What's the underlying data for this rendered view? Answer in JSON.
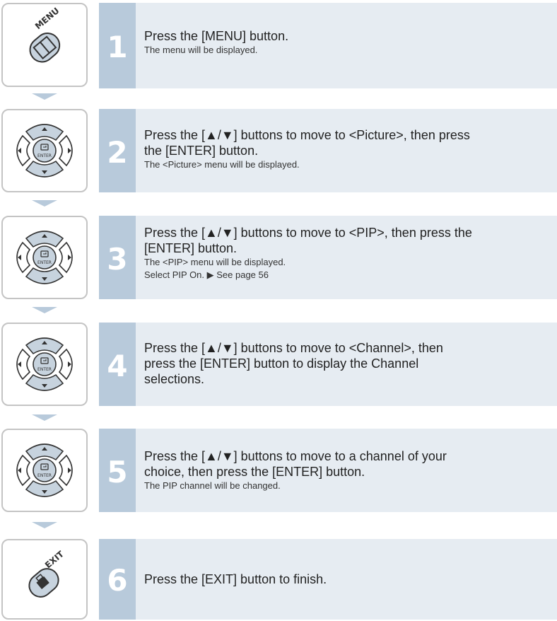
{
  "steps": [
    {
      "number": "1",
      "icon": "menu-button-icon",
      "icon_label": "MENU",
      "main": "Press the [MENU] button.",
      "sub": [
        "The menu will be displayed."
      ]
    },
    {
      "number": "2",
      "icon": "directional-pad-icon",
      "icon_label": "ENTER",
      "main_lines": [
        "Press the [▲/▼] buttons to move to <Picture>, then press",
        "the [ENTER] button."
      ],
      "sub": [
        "The <Picture> menu will be displayed."
      ]
    },
    {
      "number": "3",
      "icon": "directional-pad-icon",
      "icon_label": "ENTER",
      "main_lines": [
        "Press the [▲/▼] buttons to move to <PIP>, then press the",
        "[ENTER] button."
      ],
      "sub": [
        "The <PIP> menu will be displayed.",
        "Select PIP On. ▶ See page 56"
      ]
    },
    {
      "number": "4",
      "icon": "directional-pad-icon",
      "icon_label": "ENTER",
      "main_lines": [
        "Press the [▲/▼] buttons to move to <Channel>, then",
        "press the [ENTER] button to display the Channel",
        "selections."
      ],
      "sub": []
    },
    {
      "number": "5",
      "icon": "directional-pad-icon",
      "icon_label": "ENTER",
      "main_lines": [
        "Press the [▲/▼] buttons to move to a channel of your",
        "choice, then press the [ENTER] button."
      ],
      "sub": [
        "The PIP channel will be changed."
      ]
    },
    {
      "number": "6",
      "icon": "exit-button-icon",
      "icon_label": "EXIT",
      "main": "Press the [EXIT] button to finish.",
      "sub": []
    }
  ],
  "colors": {
    "number_column": "#b8cadb",
    "content_background": "#e6ecf2",
    "icon_border": "#c4c4c4",
    "arrow": "#b8cadb"
  }
}
